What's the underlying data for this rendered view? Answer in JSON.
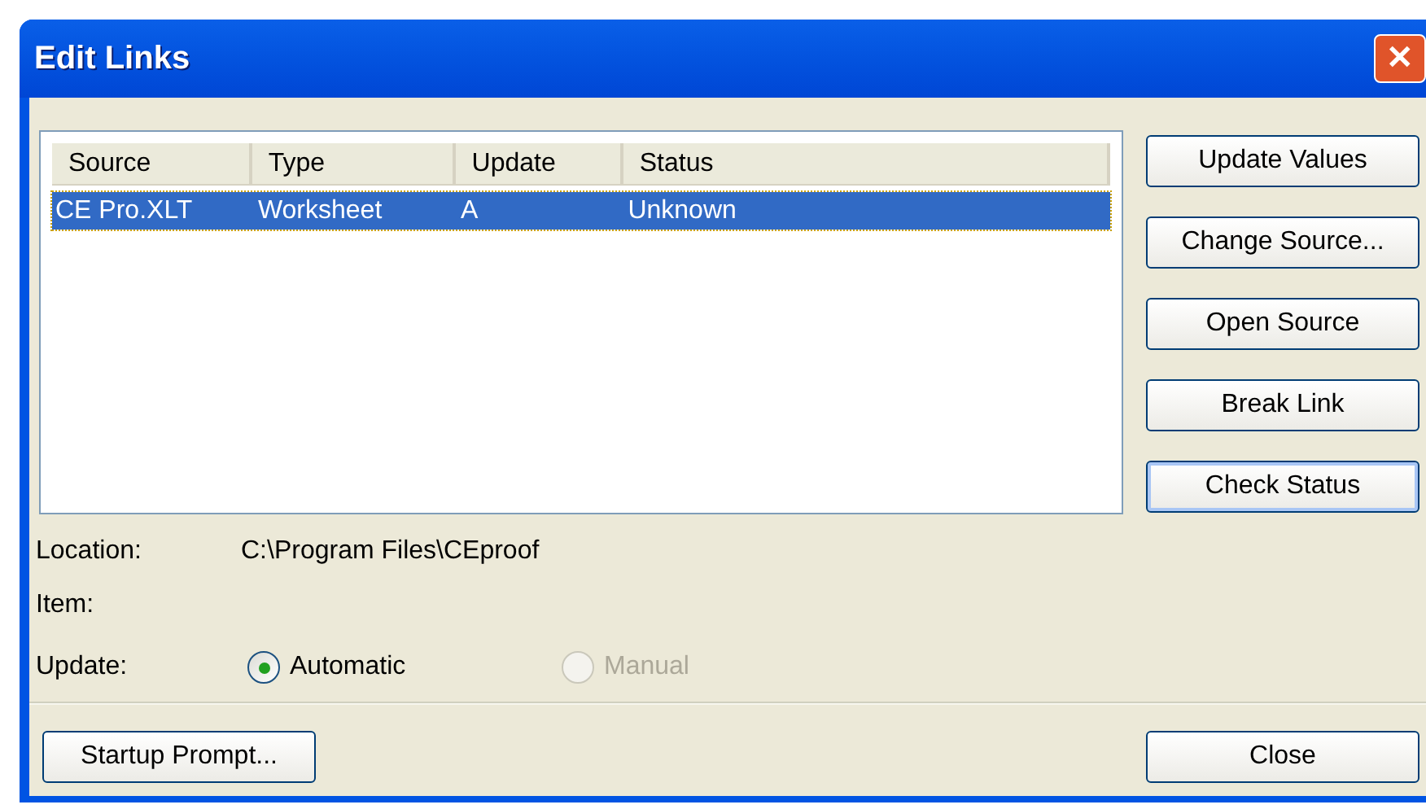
{
  "window": {
    "title": "Edit Links",
    "close_glyph": "✕"
  },
  "table": {
    "columns": [
      "Source",
      "Type",
      "Update",
      "Status"
    ],
    "rows": [
      {
        "cells": [
          "CE Pro.XLT",
          "Worksheet",
          "A",
          "Unknown"
        ],
        "selected": true
      }
    ]
  },
  "buttons": [
    {
      "label": "Update Values",
      "focused": false
    },
    {
      "label": "Change Source...",
      "focused": false
    },
    {
      "label": "Open Source",
      "focused": false
    },
    {
      "label": "Break Link",
      "focused": false
    },
    {
      "label": "Check Status",
      "focused": true
    }
  ],
  "details": [
    {
      "label": "Location:",
      "value": "C:\\Program Files\\CEproof"
    },
    {
      "label": "Item:"
    }
  ],
  "update": {
    "label": "Update:",
    "options": [
      {
        "label": "Automatic",
        "selected": true,
        "disabled": false
      },
      {
        "label": "Manual",
        "selected": false,
        "disabled": true
      }
    ]
  },
  "footer_buttons": [
    "Startup Prompt...",
    "Close"
  ]
}
